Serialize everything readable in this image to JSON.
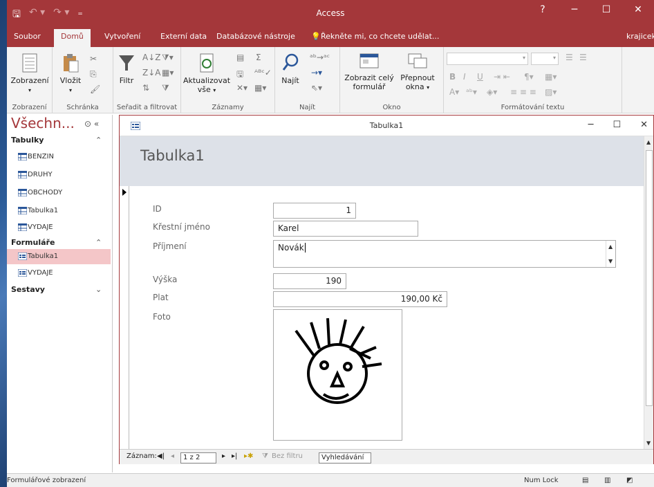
{
  "app": {
    "title": "Access",
    "user": "krajicek"
  },
  "window_controls": {
    "help": "?",
    "min": "─",
    "max": "☐",
    "close": "✕"
  },
  "tabs": [
    "Soubor",
    "Domů",
    "Vytvoření",
    "Externí data",
    "Databázové nástroje",
    "Řekněte mi, co chcete udělat..."
  ],
  "active_tab": "Domů",
  "ribbon": {
    "groups": {
      "zobrazeni": "Zobrazení",
      "schranka": "Schránka",
      "seradit": "Seřadit a filtrovat",
      "zaznamy": "Záznamy",
      "najit": "Najít",
      "okno": "Okno",
      "format": "Formátování textu"
    },
    "buttons": {
      "zobrazeni": "Zobrazení",
      "vlozit": "Vložit",
      "filtr": "Filtr",
      "aktualizovat": "Aktualizovat",
      "vse": "vše",
      "najit": "Najít",
      "zobrazit_cely": "Zobrazit celý",
      "formular": "formulář",
      "prepnout": "Přepnout",
      "okna": "okna"
    }
  },
  "nav": {
    "header": "Všechn...",
    "sections": [
      {
        "name": "Tabulky",
        "items": [
          "BENZIN",
          "DRUHY",
          "OBCHODY",
          "Tabulka1",
          "VYDAJE"
        ]
      },
      {
        "name": "Formuláře",
        "items": [
          "Tabulka1",
          "VYDAJE"
        ]
      },
      {
        "name": "Sestavy",
        "items": []
      }
    ],
    "selected": "Tabulka1"
  },
  "doc": {
    "title": "Tabulka1",
    "form_title": "Tabulka1",
    "fields": {
      "id_label": "ID",
      "id_value": "1",
      "jmeno_label": "Křestní jméno",
      "jmeno_value": "Karel",
      "prijmeni_label": "Příjmení",
      "prijmeni_value": "Novák",
      "vyska_label": "Výška",
      "vyska_value": "190",
      "plat_label": "Plat",
      "plat_value": "190,00 Kč",
      "foto_label": "Foto"
    }
  },
  "record_nav": {
    "label": "Záznam:",
    "position": "1 z 2",
    "filter": "Bez filtru",
    "search": "Vyhledávání"
  },
  "status": {
    "mode": "Formulářové zobrazení",
    "numlock": "Num Lock"
  },
  "colors": {
    "accent": "#a4373a",
    "selected_nav": "#f4c6c8",
    "form_header": "#dde1e8"
  }
}
